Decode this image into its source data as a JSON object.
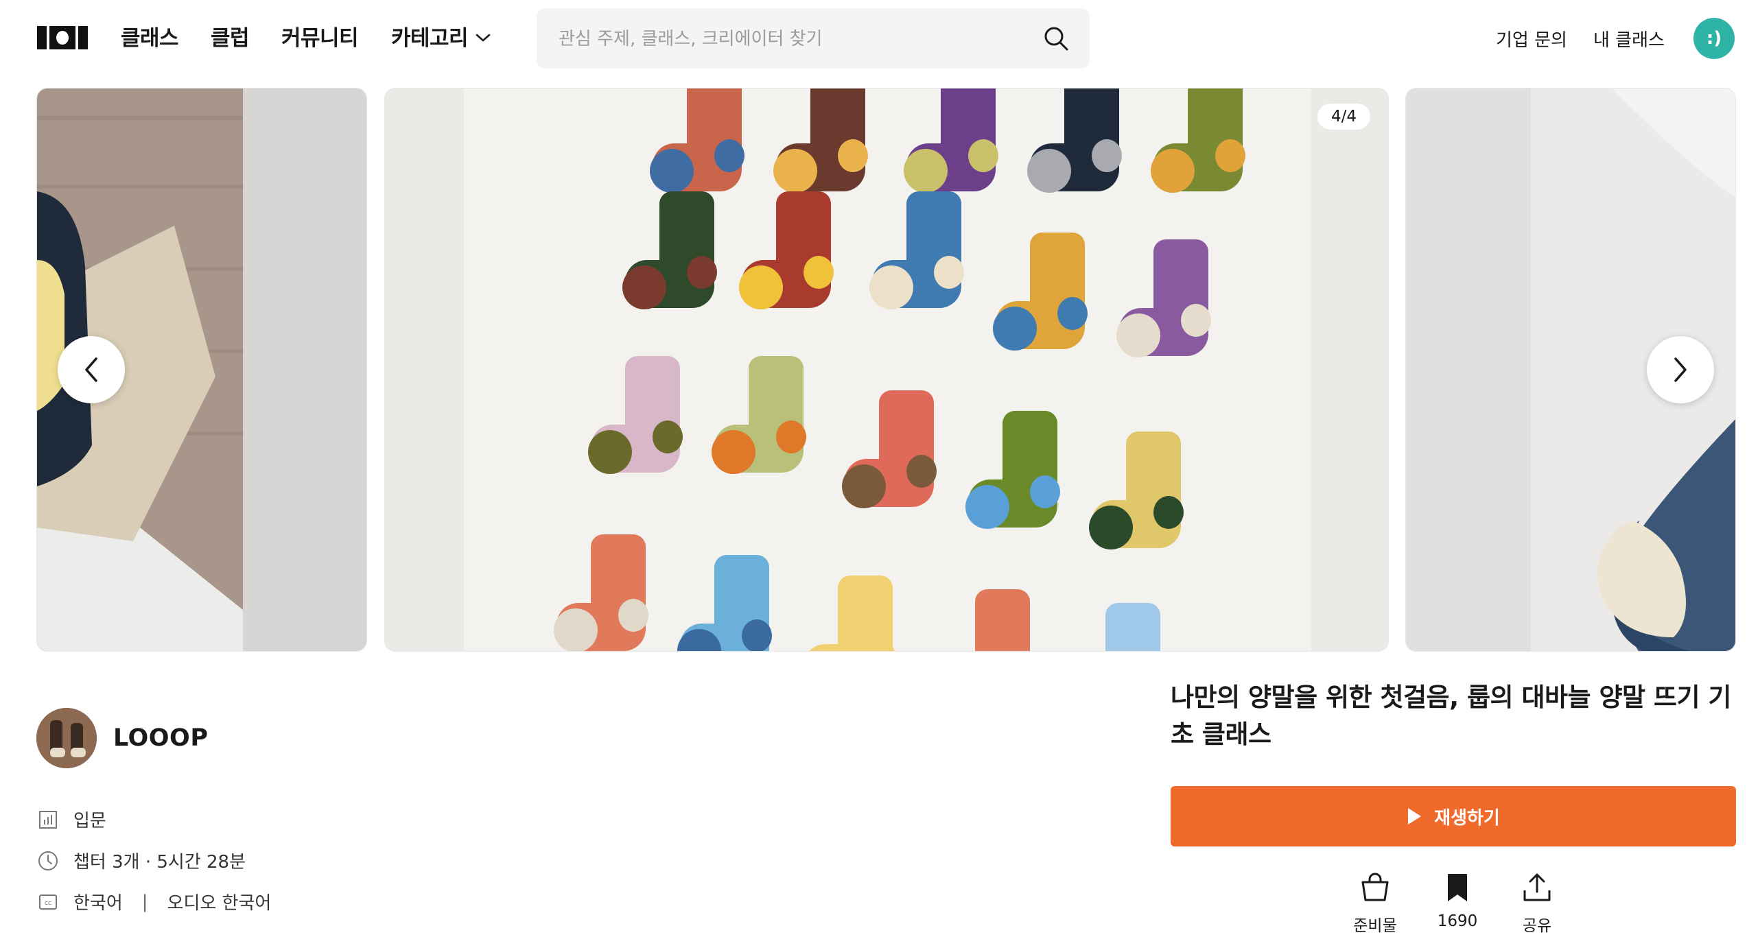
{
  "header": {
    "logo_text": "101",
    "nav": {
      "classes": "클래스",
      "club": "클럽",
      "community": "커뮤니티",
      "category": "카테고리"
    },
    "search": {
      "placeholder": "관심 주제, 클래스, 크리에이터 찾기",
      "value": ""
    },
    "inquiry": "기업 문의",
    "my_class": "내 클래스",
    "profile_face": ":)"
  },
  "carousel": {
    "counter": "4/4",
    "current": 4,
    "total": 4
  },
  "creator": {
    "name": "LOOOP"
  },
  "meta": {
    "level": "입문",
    "duration": "챕터 3개 · 5시간 28분",
    "language": "한국어",
    "separator": "|",
    "audio": "오디오 한국어"
  },
  "class": {
    "title": "나만의 양말을 위한 첫걸음, 룹의 대바늘 양말 뜨기 기초 클래스",
    "play_label": "재생하기"
  },
  "actions": {
    "supplies": "준비물",
    "bookmark_count": "1690",
    "share": "공유"
  },
  "colors": {
    "accent": "#f06a2b",
    "profile_avatar": "#2fb3a6",
    "search_bg": "#f4f4f5"
  },
  "icons": [
    "logo-icon",
    "chevron-down-icon",
    "search-icon",
    "chevron-left-icon",
    "chevron-right-icon",
    "level-chart-icon",
    "clock-icon",
    "cc-icon",
    "play-icon",
    "shopping-bag-icon",
    "bookmark-icon",
    "share-icon"
  ]
}
